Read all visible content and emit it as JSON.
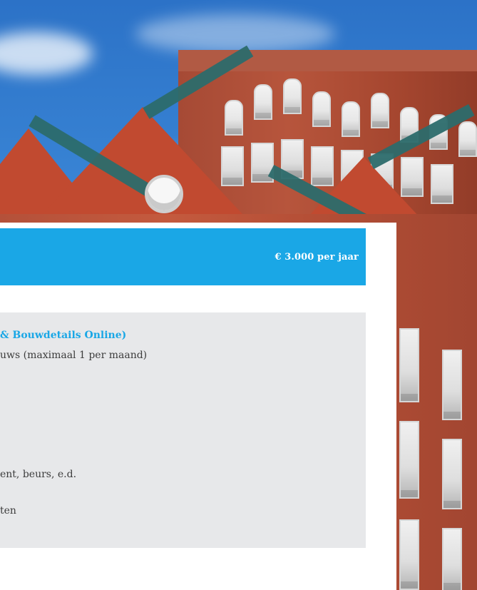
{
  "panel": {
    "price": "€ 3.000 per jaar",
    "lines": [
      "& Bouwdetails Online)",
      "uws (maximaal 1 per maand)",
      "ent, beurs, e.d.",
      "ten"
    ]
  },
  "colors": {
    "accent": "#1AA7E6",
    "panel_bg": "#E7E8EA",
    "text": "#3C3C3C"
  }
}
